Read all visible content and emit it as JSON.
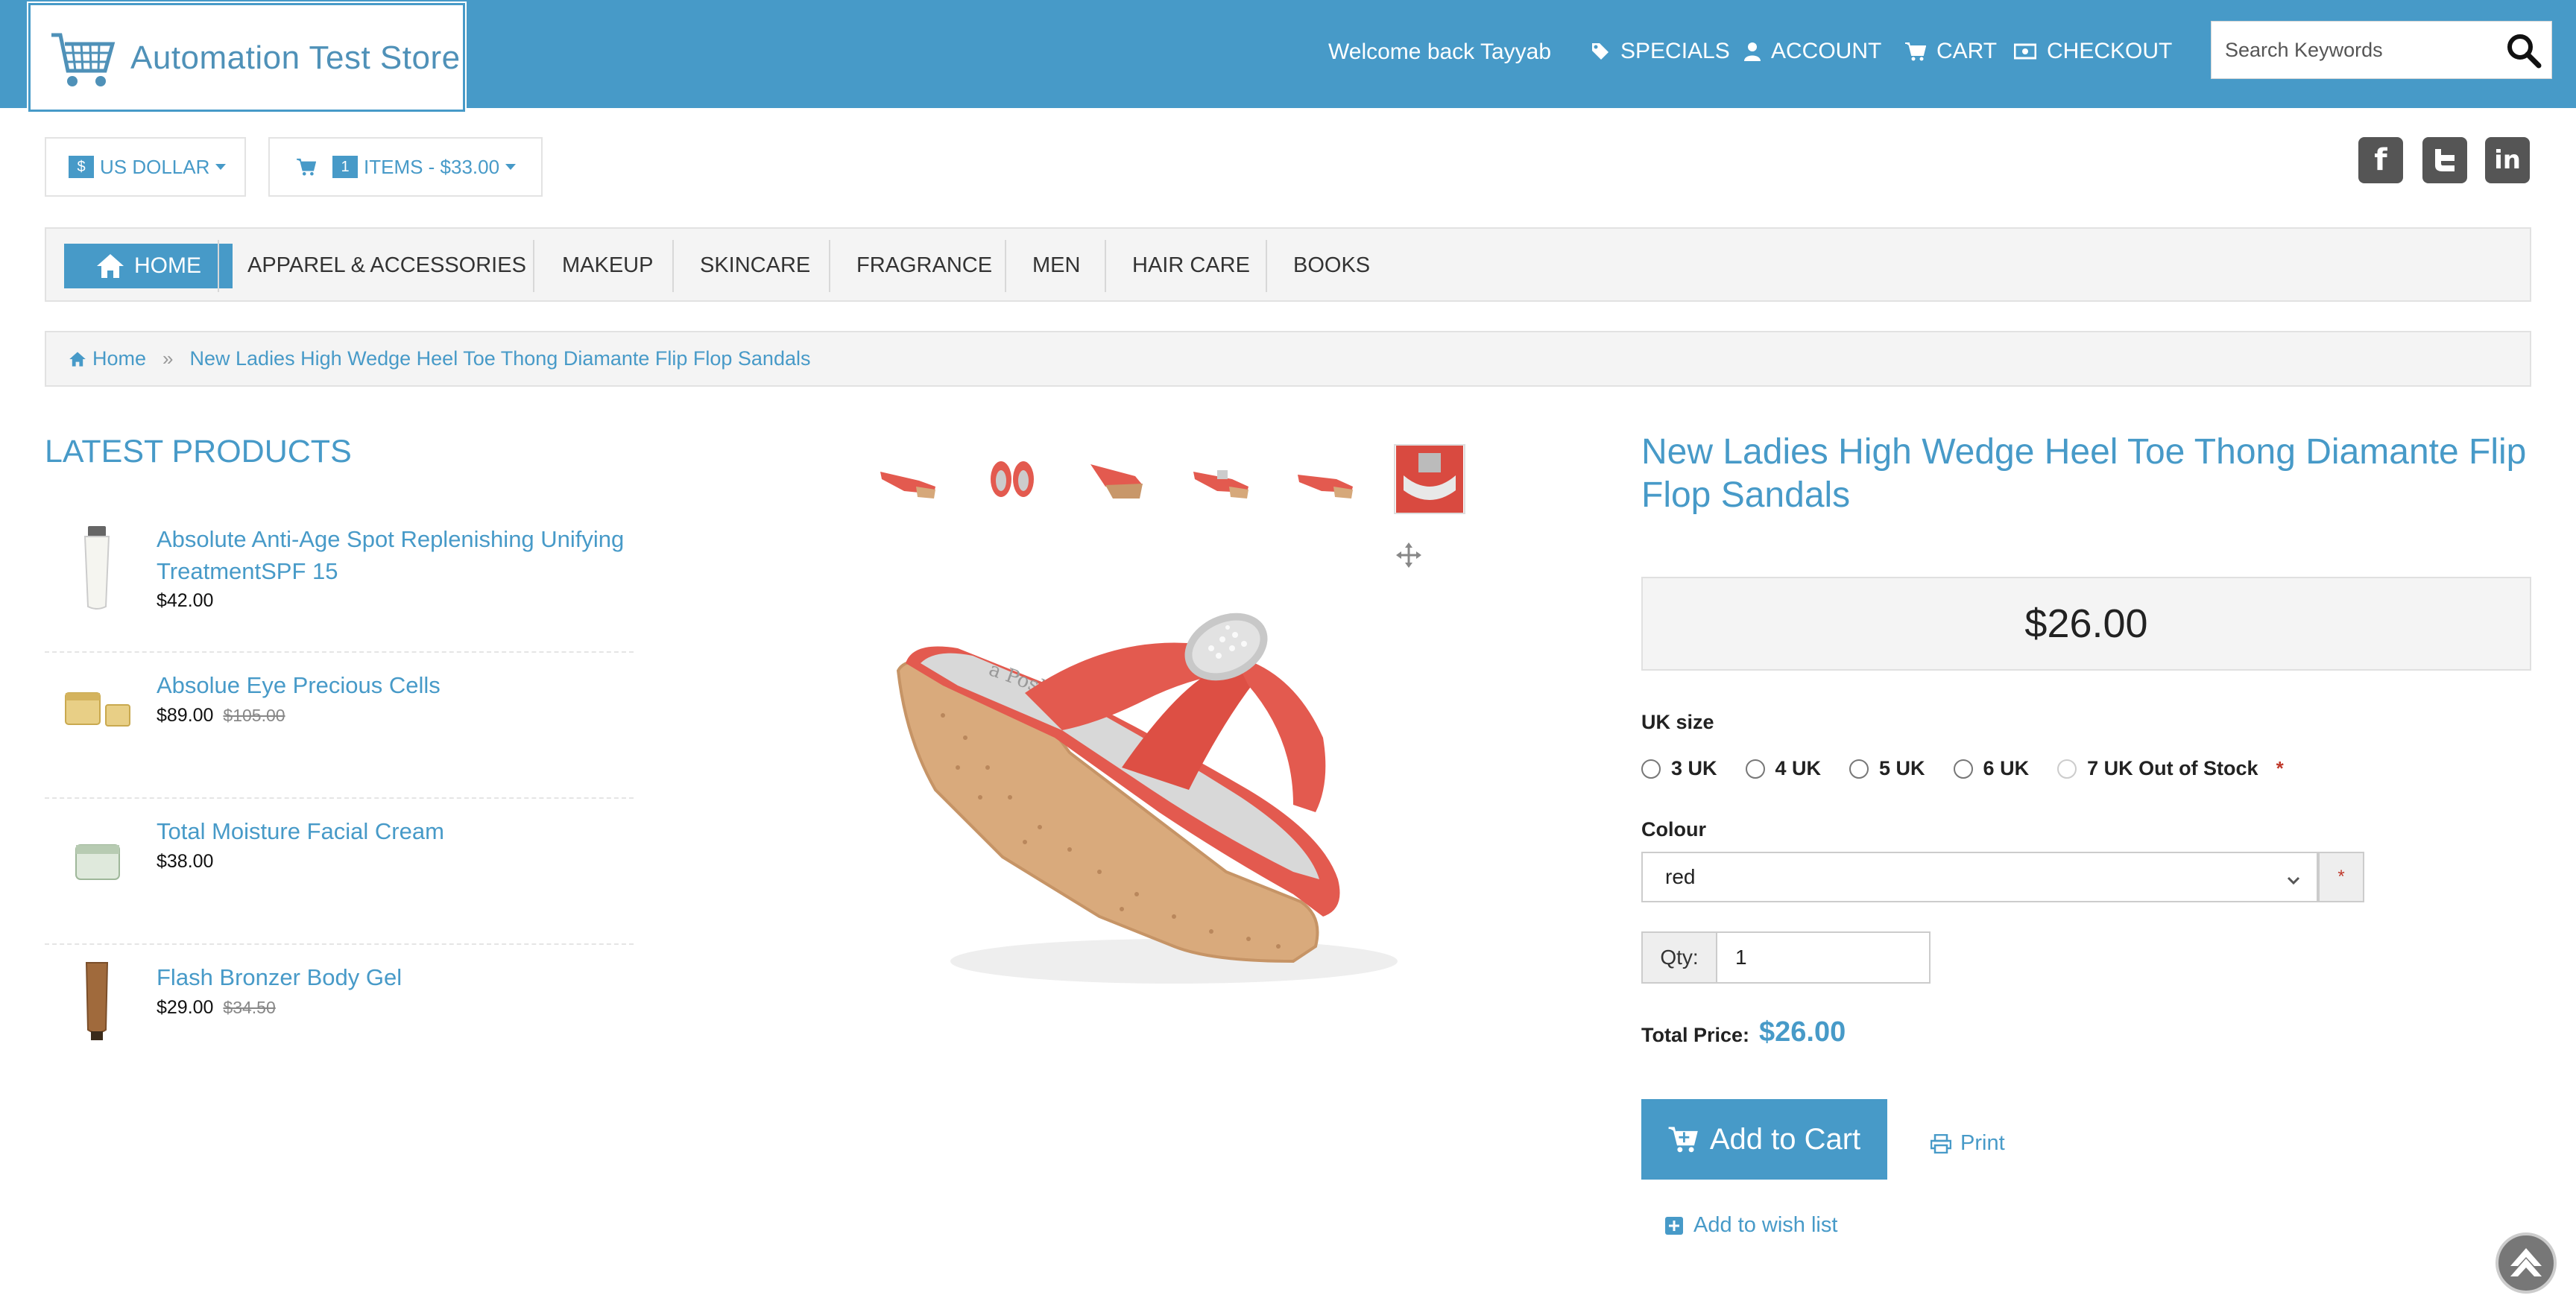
{
  "header": {
    "logo_text": "Automation Test Store",
    "welcome": "Welcome back Tayyab",
    "nav": [
      {
        "label": "SPECIALS",
        "icon": "tag-icon"
      },
      {
        "label": "ACCOUNT",
        "icon": "user-icon"
      },
      {
        "label": "CART",
        "icon": "cart-icon"
      },
      {
        "label": "CHECKOUT",
        "icon": "money-icon"
      }
    ],
    "search_placeholder": "Search Keywords"
  },
  "currency": {
    "symbol": "$",
    "label": "US DOLLAR"
  },
  "cart_summary": {
    "count": "1",
    "label": "ITEMS - $33.00"
  },
  "social": [
    "facebook-icon",
    "twitter-icon",
    "linkedin-icon"
  ],
  "menu": {
    "home": "HOME",
    "categories": [
      "APPAREL & ACCESSORIES",
      "MAKEUP",
      "SKINCARE",
      "FRAGRANCE",
      "MEN",
      "HAIR CARE",
      "BOOKS"
    ]
  },
  "breadcrumb": {
    "home": "Home",
    "current": "New Ladies High Wedge Heel Toe Thong Diamante Flip Flop Sandals"
  },
  "latest": {
    "title": "LATEST PRODUCTS",
    "items": [
      {
        "name": "Absolute Anti-Age Spot Replenishing Unifying TreatmentSPF 15",
        "price": "$42.00",
        "old_price": ""
      },
      {
        "name": "Absolue Eye Precious Cells",
        "price": "$89.00",
        "old_price": "$105.00"
      },
      {
        "name": "Total Moisture Facial Cream",
        "price": "$38.00",
        "old_price": ""
      },
      {
        "name": "Flash Bronzer Body Gel",
        "price": "$29.00",
        "old_price": "$34.50"
      }
    ]
  },
  "product": {
    "title": "New Ladies High Wedge Heel Toe Thong Diamante Flip Flop Sandals",
    "price": "$26.00",
    "size_label": "UK size",
    "sizes": [
      "3 UK",
      "4 UK",
      "5 UK",
      "6 UK",
      "7 UK Out of Stock"
    ],
    "required_mark": "*",
    "colour_label": "Colour",
    "colour_value": "red",
    "qty_label": "Qty:",
    "qty_value": "1",
    "total_label": "Total Price:",
    "total_value": "$26.00",
    "add_to_cart": "Add to Cart",
    "print": "Print",
    "wishlist": "Add to wish list"
  },
  "colors": {
    "brand": "#479ac8",
    "sandal_red": "#e35a4f",
    "wedge": "#d6a87a"
  }
}
